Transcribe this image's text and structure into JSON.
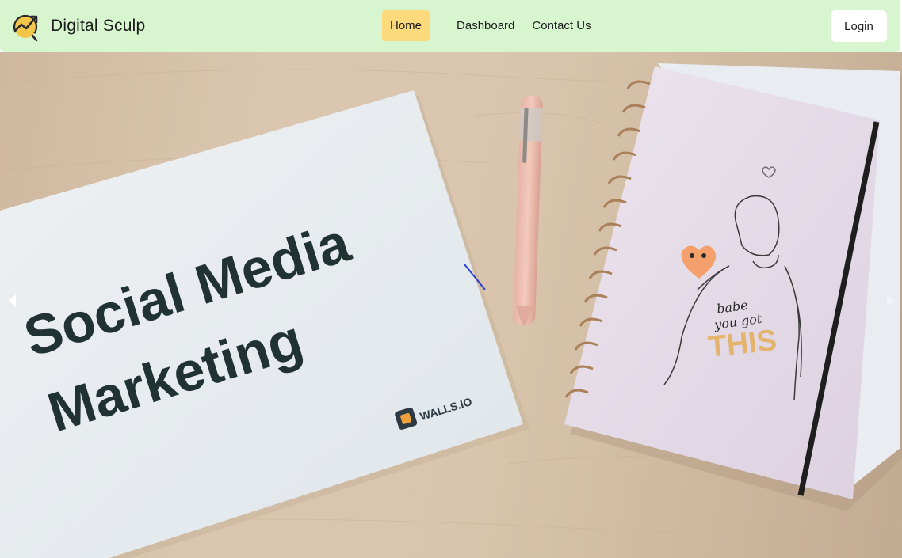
{
  "navbar": {
    "brand_name": "Digital Sculp",
    "brand_icon": "trend-chart-icon",
    "links": [
      {
        "label": "Home",
        "active": true
      },
      {
        "label": "Dashboard",
        "active": false
      },
      {
        "label": "Contact Us",
        "active": false
      }
    ],
    "login_label": "Login"
  },
  "hero": {
    "paper_line1": "Social Media",
    "paper_line2": "Marketing",
    "paper_brand": "WALLS.IO",
    "notebook_text1": "babe",
    "notebook_text2": "you got",
    "notebook_text3": "THIS",
    "prev_icon": "chevron-left-icon",
    "next_icon": "chevron-right-icon"
  },
  "colors": {
    "navbar_bg": "#d7f5cf",
    "active_link_bg": "#fcd97a",
    "accent": "#f3c64a"
  }
}
